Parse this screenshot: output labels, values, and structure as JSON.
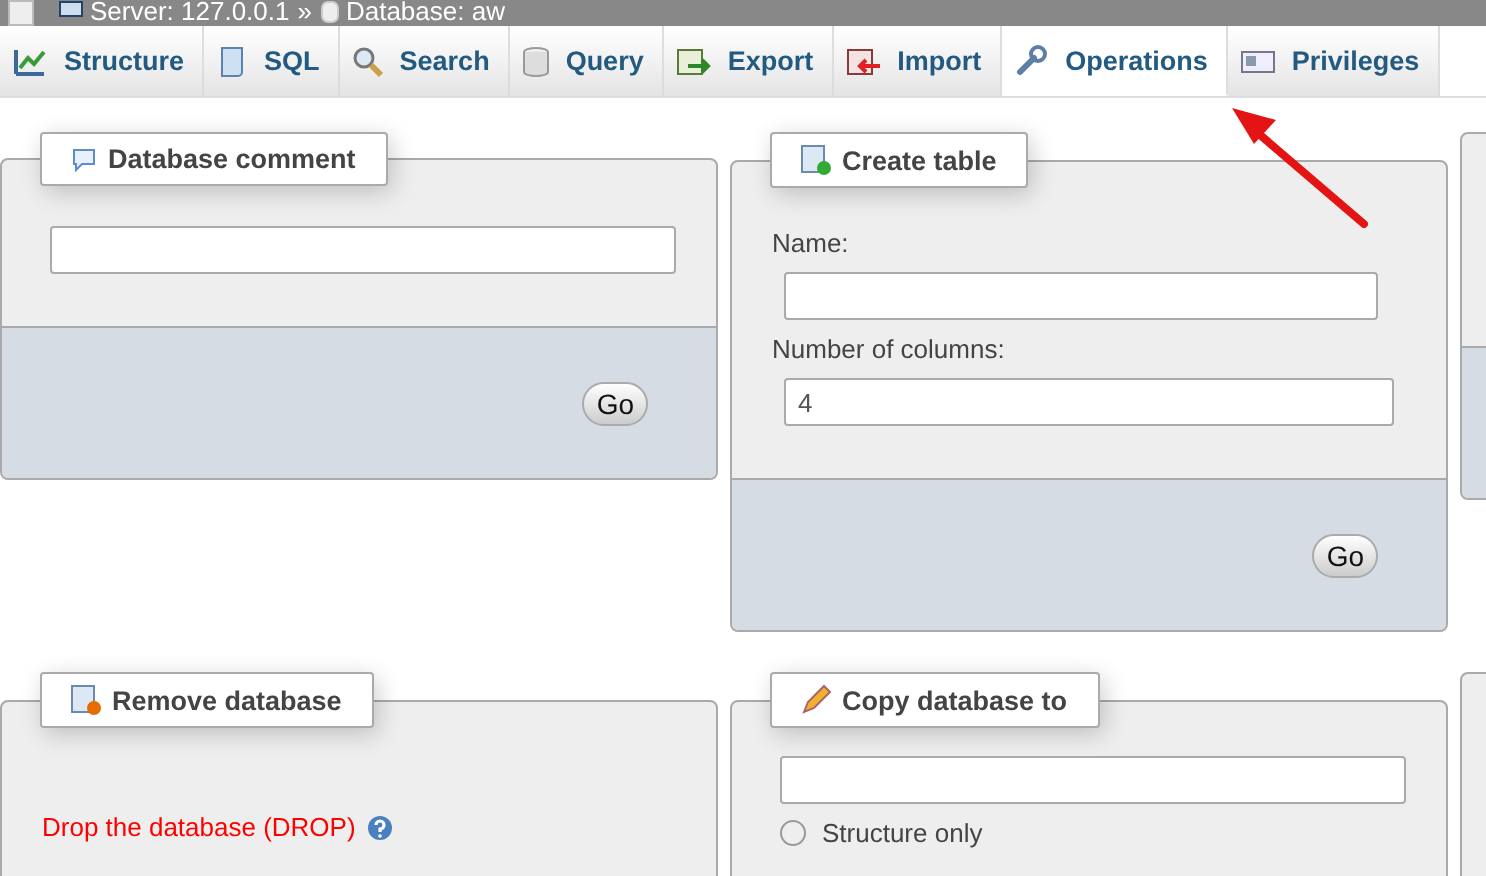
{
  "breadcrumb": {
    "server": "Server: 127.0.0.1",
    "separator": "»",
    "database": "Database: aw"
  },
  "tabs": [
    {
      "label": "Structure",
      "selected": false
    },
    {
      "label": "SQL",
      "selected": false
    },
    {
      "label": "Search",
      "selected": false
    },
    {
      "label": "Query",
      "selected": false
    },
    {
      "label": "Export",
      "selected": false
    },
    {
      "label": "Import",
      "selected": false
    },
    {
      "label": "Operations",
      "selected": true
    },
    {
      "label": "Privileges",
      "selected": false
    }
  ],
  "panels": [
    {
      "legend": "Database comment",
      "items": [
        {
          "kind": "input"
        }
      ],
      "footer_button": "Go"
    },
    {
      "legend": "Create table",
      "items": [
        {
          "kind": "label",
          "text": "Name:"
        },
        {
          "kind": "input"
        },
        {
          "kind": "label",
          "text": "Number of columns:"
        },
        {
          "kind": "input",
          "value": "4"
        }
      ],
      "footer_button": "Go"
    },
    {
      "has_footer": true
    },
    {
      "legend": "Remove database",
      "items": [
        {
          "kind": "drop-link",
          "text": "Drop the database (DROP)"
        }
      ]
    },
    {
      "legend": "Copy database to",
      "items": [
        {
          "kind": "input"
        },
        {
          "kind": "radio",
          "label": "Structure only",
          "selected": false
        }
      ]
    },
    {
      "has_footer": false
    }
  ]
}
